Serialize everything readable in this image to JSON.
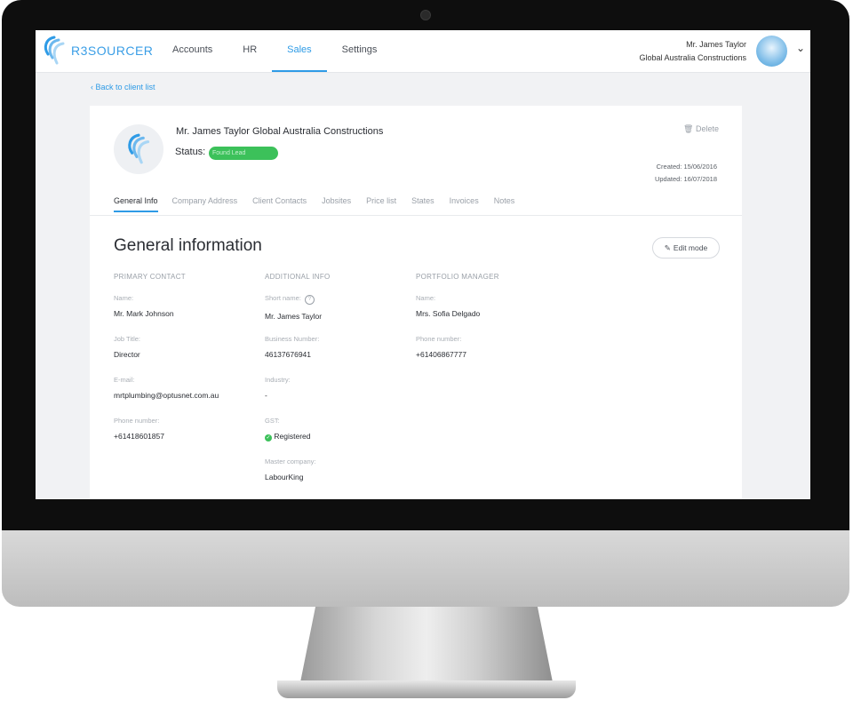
{
  "app": {
    "brand": "R3SOURCER",
    "accent": "#2e9be6",
    "status_color": "#3cc15a"
  },
  "nav": {
    "items": [
      "Accounts",
      "HR",
      "Sales",
      "Settings"
    ],
    "active": "Sales"
  },
  "user": {
    "name": "Mr. James Taylor",
    "company": "Global Australia Constructions"
  },
  "back_link": "‹ Back to client list",
  "client": {
    "title": "Mr. James Taylor Global Australia  Constructions",
    "status_label": "Status:",
    "status_value": "Found Lead",
    "delete_label": "Delete",
    "created": "Created: 15/06/2016",
    "updated": "Updated: 16/07/2018"
  },
  "tabs": [
    "General Info",
    "Company Address",
    "Client Contacts",
    "Jobsites",
    "Price list",
    "States",
    "Invoices",
    "Notes"
  ],
  "general": {
    "title": "General information",
    "edit_label": "Edit mode",
    "primary": {
      "heading": "PRIMARY CONTACT",
      "fields": [
        {
          "label": "Name:",
          "value": "Mr. Mark Johnson"
        },
        {
          "label": "Job Title:",
          "value": "Director"
        },
        {
          "label": "E-mail:",
          "value": "mrtplumbing@optusnet.com.au"
        },
        {
          "label": "Phone number:",
          "value": "+61418601857"
        }
      ]
    },
    "additional": {
      "heading": "ADDITIONAL INFO",
      "fields": [
        {
          "label": "Short name:",
          "value": "Mr. James Taylor"
        },
        {
          "label": "Business Number:",
          "value": "46137676941"
        },
        {
          "label": "Industry:",
          "value": "-"
        },
        {
          "label": "GST:",
          "value": "Registered"
        },
        {
          "label": "Master company:",
          "value": "LabourKing"
        }
      ]
    },
    "portfolio": {
      "heading": "PORTFOLIO MANAGER",
      "fields": [
        {
          "label": "Name:",
          "value": "Mrs. Sofia Delgado"
        },
        {
          "label": "Phone number:",
          "value": "+61406867777"
        }
      ]
    }
  }
}
